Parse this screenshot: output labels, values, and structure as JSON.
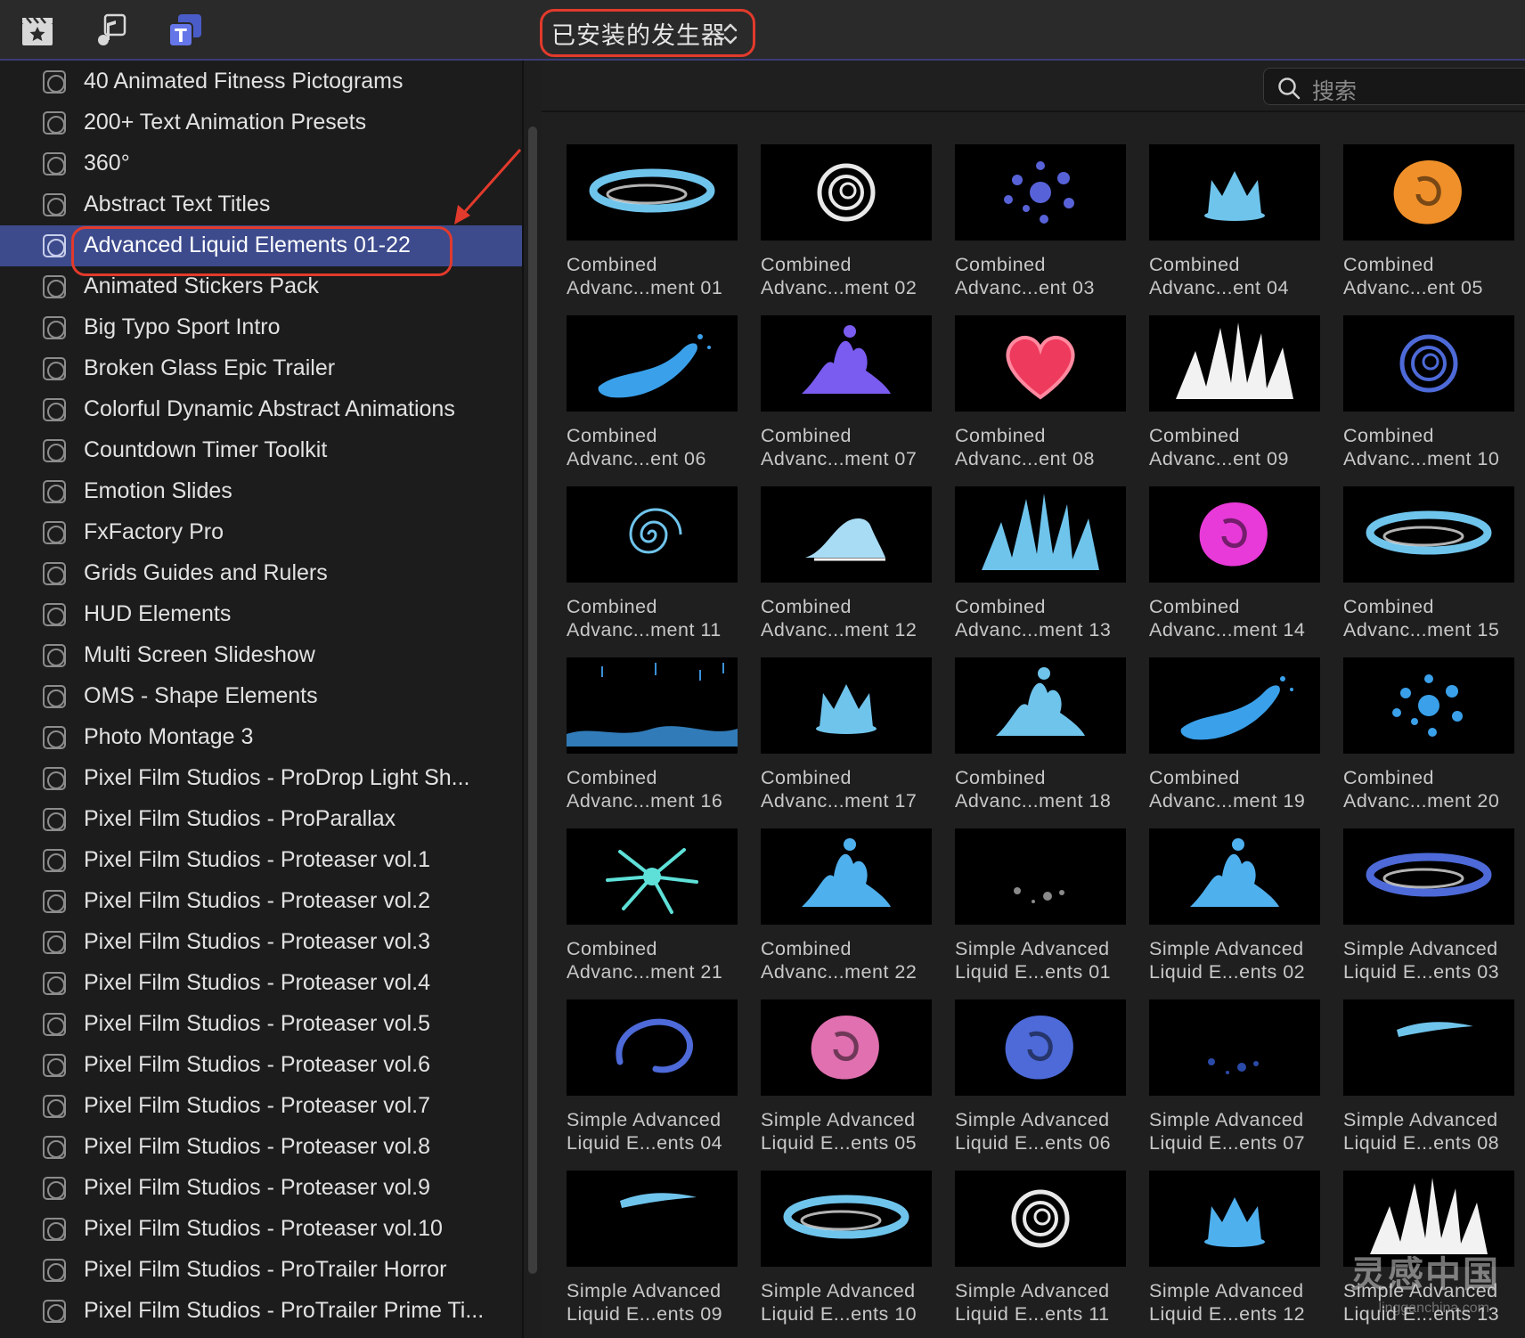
{
  "toolbar": {
    "icons": [
      "clapper-star-icon",
      "music-photo-icon",
      "titles-icon"
    ],
    "generator_popup": "已安装的发生器"
  },
  "search": {
    "placeholder": "搜索"
  },
  "sidebar": {
    "items": [
      {
        "label": "40 Animated Fitness Pictograms"
      },
      {
        "label": "200+ Text Animation Presets"
      },
      {
        "label": "360°"
      },
      {
        "label": "Abstract Text Titles"
      },
      {
        "label": "Advanced Liquid Elements 01-22",
        "selected": true
      },
      {
        "label": "Animated Stickers Pack"
      },
      {
        "label": "Big Typo Sport Intro"
      },
      {
        "label": "Broken Glass Epic Trailer"
      },
      {
        "label": "Colorful Dynamic Abstract Animations"
      },
      {
        "label": "Countdown Timer Toolkit"
      },
      {
        "label": "Emotion Slides"
      },
      {
        "label": "FxFactory Pro"
      },
      {
        "label": "Grids Guides and Rulers"
      },
      {
        "label": "HUD Elements"
      },
      {
        "label": "Multi Screen Slideshow"
      },
      {
        "label": "OMS - Shape Elements"
      },
      {
        "label": "Photo Montage 3"
      },
      {
        "label": "Pixel Film Studios - ProDrop Light Sh..."
      },
      {
        "label": "Pixel Film Studios - ProParallax"
      },
      {
        "label": "Pixel Film Studios - Proteaser vol.1"
      },
      {
        "label": "Pixel Film Studios - Proteaser vol.2"
      },
      {
        "label": "Pixel Film Studios - Proteaser vol.3"
      },
      {
        "label": "Pixel Film Studios - Proteaser vol.4"
      },
      {
        "label": "Pixel Film Studios - Proteaser vol.5"
      },
      {
        "label": "Pixel Film Studios - Proteaser vol.6"
      },
      {
        "label": "Pixel Film Studios - Proteaser vol.7"
      },
      {
        "label": "Pixel Film Studios - Proteaser vol.8"
      },
      {
        "label": "Pixel Film Studios - Proteaser vol.9"
      },
      {
        "label": "Pixel Film Studios - Proteaser vol.10"
      },
      {
        "label": "Pixel Film Studios - ProTrailer Horror"
      },
      {
        "label": "Pixel Film Studios - ProTrailer Prime Ti..."
      }
    ]
  },
  "grid": {
    "items": [
      {
        "line1": "Combined",
        "line2": "Advanc...ment 01",
        "color": "#6fc4ec",
        "shape": "ring"
      },
      {
        "line1": "Combined",
        "line2": "Advanc...ment 02",
        "color": "#e8e8e8",
        "shape": "swirl"
      },
      {
        "line1": "Combined",
        "line2": "Advanc...ent 03",
        "color": "#5862d8",
        "shape": "dots"
      },
      {
        "line1": "Combined",
        "line2": "Advanc...ent 04",
        "color": "#6fc4ec",
        "shape": "crown"
      },
      {
        "line1": "Combined",
        "line2": "Advanc...ent 05",
        "color": "#f0902a",
        "shape": "blob"
      },
      {
        "line1": "Combined",
        "line2": "Advanc...ent 06",
        "color": "#3aa0ea",
        "shape": "wave"
      },
      {
        "line1": "Combined",
        "line2": "Advanc...ment 07",
        "color": "#7a5cf0",
        "shape": "splash"
      },
      {
        "line1": "Combined",
        "line2": "Advanc...ent 08",
        "color": "#ee3a5c",
        "shape": "heart"
      },
      {
        "line1": "Combined",
        "line2": "Advanc...ent 09",
        "color": "#f2f2f2",
        "shape": "spikes"
      },
      {
        "line1": "Combined",
        "line2": "Advanc...ment 10",
        "color": "#4d6ad8",
        "shape": "swirl"
      },
      {
        "line1": "Combined",
        "line2": "Advanc...ment 11",
        "color": "#6fc4ec",
        "shape": "spiral"
      },
      {
        "line1": "Combined",
        "line2": "Advanc...ment 12",
        "color": "#a8dcf4",
        "shape": "crest"
      },
      {
        "line1": "Combined",
        "line2": "Advanc...ment 13",
        "color": "#6fc4ec",
        "shape": "spikes"
      },
      {
        "line1": "Combined",
        "line2": "Advanc...ment 14",
        "color": "#e83ad8",
        "shape": "blob"
      },
      {
        "line1": "Combined",
        "line2": "Advanc...ment 15",
        "color": "#6fc4ec",
        "shape": "ring"
      },
      {
        "line1": "Combined",
        "line2": "Advanc...ment 16",
        "color": "#3a90d8",
        "shape": "rain"
      },
      {
        "line1": "Combined",
        "line2": "Advanc...ment 17",
        "color": "#6fc4ec",
        "shape": "crown"
      },
      {
        "line1": "Combined",
        "line2": "Advanc...ment 18",
        "color": "#6fc4ec",
        "shape": "splash"
      },
      {
        "line1": "Combined",
        "line2": "Advanc...ment 19",
        "color": "#3aa0ea",
        "shape": "wave"
      },
      {
        "line1": "Combined",
        "line2": "Advanc...ment 20",
        "color": "#3aa0ea",
        "shape": "dots"
      },
      {
        "line1": "Combined",
        "line2": "Advanc...ment 21",
        "color": "#5ee0d8",
        "shape": "burst"
      },
      {
        "line1": "Combined",
        "line2": "Advanc...ment 22",
        "color": "#4fb0ee",
        "shape": "splash"
      },
      {
        "line1": "Simple Advanced",
        "line2": "Liquid E...ents 01",
        "color": "#8a8a8a",
        "shape": "specks"
      },
      {
        "line1": "Simple Advanced",
        "line2": "Liquid E...ents 02",
        "color": "#4fb0ee",
        "shape": "splash"
      },
      {
        "line1": "Simple Advanced",
        "line2": "Liquid E...ents 03",
        "color": "#4d6ad8",
        "shape": "ring"
      },
      {
        "line1": "Simple Advanced",
        "line2": "Liquid E...ents 04",
        "color": "#4d6ad8",
        "shape": "arc"
      },
      {
        "line1": "Simple Advanced",
        "line2": "Liquid E...ents 05",
        "color": "#e070b0",
        "shape": "blob"
      },
      {
        "line1": "Simple Advanced",
        "line2": "Liquid E...ents 06",
        "color": "#4d6ad8",
        "shape": "blob"
      },
      {
        "line1": "Simple Advanced",
        "line2": "Liquid E...ents 07",
        "color": "#2a4aa8",
        "shape": "specks"
      },
      {
        "line1": "Simple Advanced",
        "line2": "Liquid E...ents 08",
        "color": "#6fc4ec",
        "shape": "stroke"
      },
      {
        "line1": "Simple Advanced",
        "line2": "Liquid E...ents 09",
        "color": "#6fc4ec",
        "shape": "stroke"
      },
      {
        "line1": "Simple Advanced",
        "line2": "Liquid E...ents 10",
        "color": "#6fc4ec",
        "shape": "ring"
      },
      {
        "line1": "Simple Advanced",
        "line2": "Liquid E...ents 11",
        "color": "#e8e8e8",
        "shape": "swirl"
      },
      {
        "line1": "Simple Advanced",
        "line2": "Liquid E...ents 12",
        "color": "#4fb0ee",
        "shape": "crown"
      },
      {
        "line1": "Simple Advanced",
        "line2": "Liquid E...ents 13",
        "color": "#f2f2f2",
        "shape": "spikes"
      }
    ]
  },
  "watermark": {
    "text": "灵感中国",
    "sub": "lingganchina.com"
  }
}
